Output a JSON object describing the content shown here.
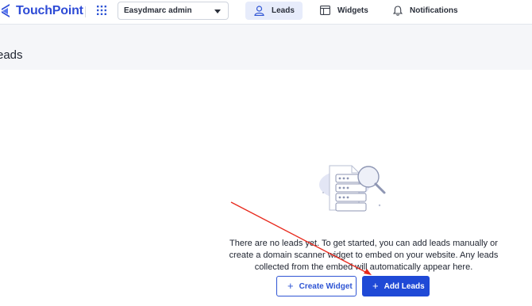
{
  "header": {
    "brand_name": "TouchPoint",
    "account_select": {
      "value": "Easydmarc admin"
    },
    "nav": [
      {
        "label": "Leads",
        "icon": "user-icon",
        "active": true
      },
      {
        "label": "Widgets",
        "icon": "widget-icon",
        "active": false
      },
      {
        "label": "Notifications",
        "icon": "bell-icon",
        "active": false
      }
    ]
  },
  "page": {
    "title": "eads"
  },
  "empty_state": {
    "message": "There are no leads yet. To get started, you can add leads manually or create a domain scanner widget to embed on your website. Any leads collected from the embed will automatically appear here.",
    "illustration": "document-search-icon",
    "buttons": {
      "create_widget": {
        "label": "Create Widget",
        "icon": "plus-icon"
      },
      "add_leads": {
        "label": "Add Leads",
        "icon": "plus-icon"
      }
    }
  },
  "annotation": {
    "type": "arrow",
    "color": "#e8291c"
  },
  "colors": {
    "brand": "#2f4cd6",
    "primary_button": "#1f49d6",
    "active_nav_bg": "#e7ecfb",
    "header_band_bg": "#f5f6f9"
  }
}
